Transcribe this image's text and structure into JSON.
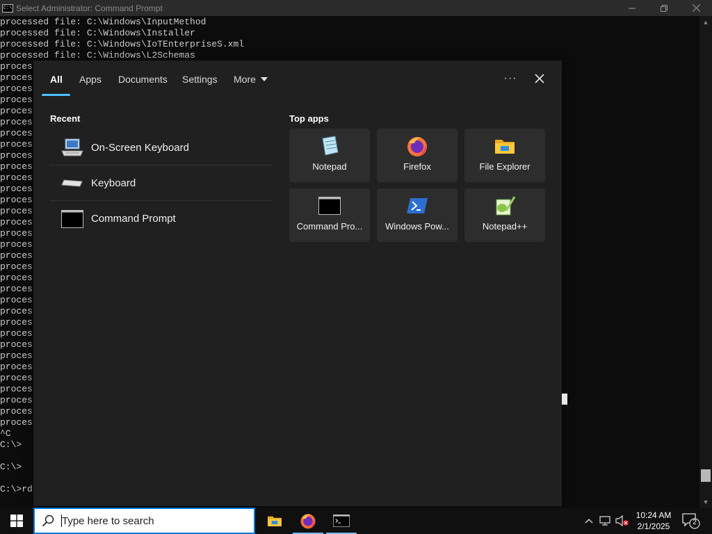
{
  "window": {
    "title": "Select Administrator: Command Prompt",
    "icon_text": "C:\\"
  },
  "console": {
    "lines": [
      "processed file: C:\\Windows\\InputMethod",
      "processed file: C:\\Windows\\Installer",
      "processed file: C:\\Windows\\IoTEnterpriseS.xml",
      "processed file: C:\\Windows\\L2Schemas",
      "proces",
      "proces",
      "proces",
      "proces",
      "proces",
      "proces",
      "proces",
      "proces",
      "proces",
      "proces",
      "proces",
      "proces",
      "proces",
      "proces",
      "proces",
      "proces",
      "proces",
      "proces",
      "proces",
      "proces",
      "proces",
      "proces",
      "proces",
      "proces",
      "proces",
      "proces",
      "proces",
      "proces",
      "proces",
      "proces",
      "proces",
      "proces",
      "proces",
      "^C",
      "C:\\>",
      "",
      "C:\\>",
      "",
      "C:\\>rd"
    ]
  },
  "search_flyout": {
    "tabs": [
      {
        "label": "All",
        "active": true
      },
      {
        "label": "Apps"
      },
      {
        "label": "Documents"
      },
      {
        "label": "Settings"
      },
      {
        "label": "More"
      }
    ],
    "recent_title": "Recent",
    "recent": [
      {
        "label": "On-Screen Keyboard",
        "icon": "on-screen-keyboard-icon"
      },
      {
        "label": "Keyboard",
        "icon": "keyboard-icon"
      },
      {
        "label": "Command Prompt",
        "icon": "command-prompt-icon"
      }
    ],
    "top_apps_title": "Top apps",
    "top_apps": [
      {
        "label": "Notepad",
        "icon": "notepad-icon"
      },
      {
        "label": "Firefox",
        "icon": "firefox-icon"
      },
      {
        "label": "File Explorer",
        "icon": "file-explorer-icon"
      },
      {
        "label": "Command Pro...",
        "icon": "command-prompt-icon"
      },
      {
        "label": "Windows Pow...",
        "icon": "powershell-icon"
      },
      {
        "label": "Notepad++",
        "icon": "notepad-plus-plus-icon"
      }
    ]
  },
  "taskbar": {
    "search_placeholder": "Type here to search",
    "time": "10:24 AM",
    "date": "2/1/2025",
    "notification_count": "2"
  },
  "colors": {
    "accent": "#4cc2ff",
    "search_border": "#0078d7",
    "flyout_bg": "#202020",
    "tile_bg": "#2d2d2d"
  }
}
